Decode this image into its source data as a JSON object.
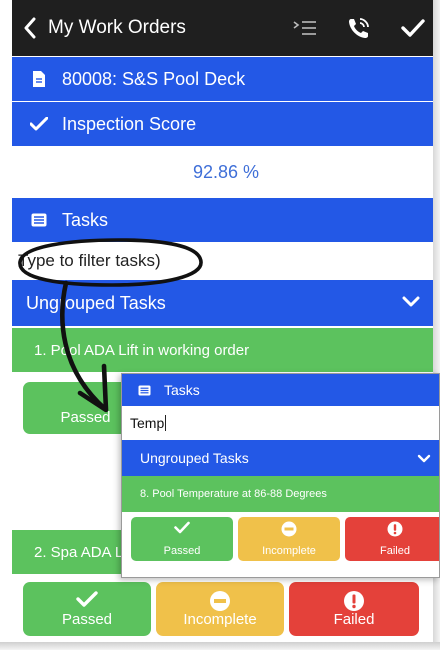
{
  "topbar": {
    "title": "My Work Orders",
    "icons": [
      "back-chevron-icon",
      "list-indent-icon",
      "phone-call-icon",
      "check-icon"
    ]
  },
  "work_order": {
    "label": "80008: S&S Pool Deck",
    "icon": "document-icon"
  },
  "inspection": {
    "label": "Inspection Score",
    "icon": "check-icon",
    "score": "92.86 %"
  },
  "tasks_header": {
    "label": "Tasks",
    "icon": "list-icon"
  },
  "filter": {
    "placeholder": "Type to filter tasks)"
  },
  "group": {
    "label": "Ungrouped Tasks",
    "icon": "chevron-down-icon"
  },
  "tasks": [
    {
      "label": "1. Pool ADA Lift in working order"
    },
    {
      "label": "2. Spa ADA L"
    }
  ],
  "buttons": {
    "passed": "Passed",
    "incomplete": "Incomplete",
    "failed": "Failed"
  },
  "inset": {
    "tasks_label": "Tasks",
    "filter_value": "Temp",
    "group_label": "Ungrouped Tasks",
    "task_label": "8. Pool Temperature at 86-88 Degrees",
    "buttons": {
      "passed": "Passed",
      "incomplete": "Incomplete",
      "failed": "Failed"
    }
  },
  "colors": {
    "topbar": "#1f1f1f",
    "blue": "#2358e6",
    "green": "#5cc25e",
    "yellow": "#f0c14a",
    "red": "#e4413a",
    "score": "#3f6fd8"
  }
}
